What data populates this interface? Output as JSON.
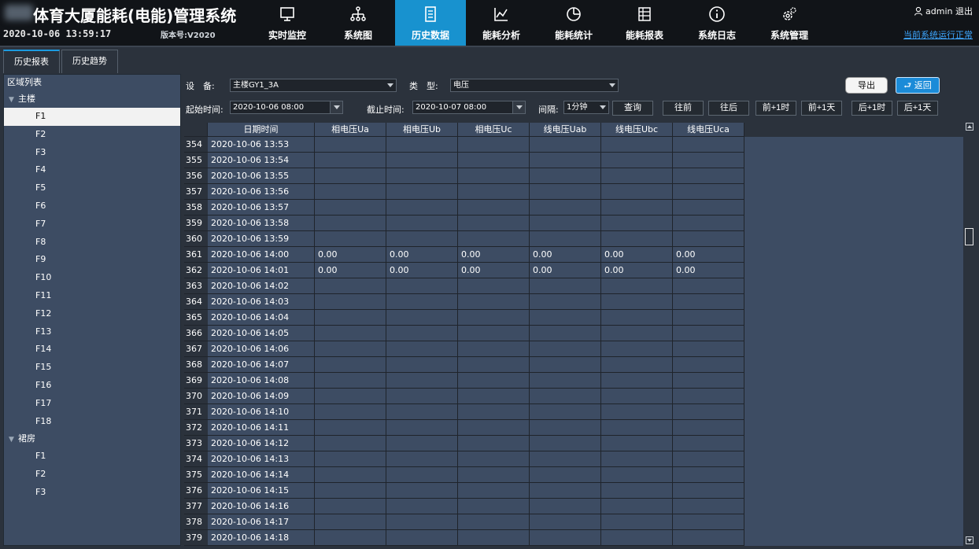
{
  "header": {
    "title": "体育大厦能耗(电能)管理系统",
    "datetime": "2020-10-06 13:59:17",
    "version": "版本号:V2020",
    "user": "admin",
    "logout": "退出",
    "status_link": "当前系统运行正常"
  },
  "nav": [
    {
      "label": "实时监控",
      "icon": "monitor-icon"
    },
    {
      "label": "系统图",
      "icon": "hierarchy-icon"
    },
    {
      "label": "历史数据",
      "icon": "document-icon",
      "active": true
    },
    {
      "label": "能耗分析",
      "icon": "line-chart-icon"
    },
    {
      "label": "能耗统计",
      "icon": "pie-chart-icon"
    },
    {
      "label": "能耗报表",
      "icon": "report-icon"
    },
    {
      "label": "系统日志",
      "icon": "info-icon"
    },
    {
      "label": "系统管理",
      "icon": "gear-icon"
    }
  ],
  "subtabs": [
    "历史报表",
    "历史趋势"
  ],
  "tree": {
    "title": "区域列表",
    "groups": [
      {
        "name": "主楼",
        "items": [
          "F1",
          "F2",
          "F3",
          "F4",
          "F5",
          "F6",
          "F7",
          "F8",
          "F9",
          "F10",
          "F11",
          "F12",
          "F13",
          "F14",
          "F15",
          "F16",
          "F17",
          "F18"
        ]
      },
      {
        "name": "裙房",
        "items": [
          "F1",
          "F2",
          "F3"
        ]
      }
    ],
    "selected": "F1"
  },
  "filters": {
    "device_label": "设　备:",
    "device_value": "主楼GY1_3A",
    "type_label": "类　型:",
    "type_value": "电压",
    "start_label": "起始时间:",
    "start_value": "2020-10-06 08:00",
    "end_label": "截止时间:",
    "end_value": "2020-10-07 08:00",
    "interval_label": "间隔:",
    "interval_value": "1分钟",
    "query": "查询",
    "prev": "往前",
    "next": "往后",
    "prev_hour": "前+1时",
    "prev_day": "前+1天",
    "next_hour": "后+1时",
    "next_day": "后+1天",
    "export": "导出",
    "back": "返回"
  },
  "table": {
    "columns": [
      "日期时间",
      "相电压Ua",
      "相电压Ub",
      "相电压Uc",
      "线电压Uab",
      "线电压Ubc",
      "线电压Uca"
    ],
    "rows": [
      {
        "idx": "354",
        "time": "2020-10-06 13:53",
        "vals": [
          "",
          "",
          "",
          "",
          "",
          ""
        ]
      },
      {
        "idx": "355",
        "time": "2020-10-06 13:54",
        "vals": [
          "",
          "",
          "",
          "",
          "",
          ""
        ]
      },
      {
        "idx": "356",
        "time": "2020-10-06 13:55",
        "vals": [
          "",
          "",
          "",
          "",
          "",
          ""
        ]
      },
      {
        "idx": "357",
        "time": "2020-10-06 13:56",
        "vals": [
          "",
          "",
          "",
          "",
          "",
          ""
        ]
      },
      {
        "idx": "358",
        "time": "2020-10-06 13:57",
        "vals": [
          "",
          "",
          "",
          "",
          "",
          ""
        ]
      },
      {
        "idx": "359",
        "time": "2020-10-06 13:58",
        "vals": [
          "",
          "",
          "",
          "",
          "",
          ""
        ]
      },
      {
        "idx": "360",
        "time": "2020-10-06 13:59",
        "vals": [
          "",
          "",
          "",
          "",
          "",
          ""
        ]
      },
      {
        "idx": "361",
        "time": "2020-10-06 14:00",
        "vals": [
          "0.00",
          "0.00",
          "0.00",
          "0.00",
          "0.00",
          "0.00"
        ]
      },
      {
        "idx": "362",
        "time": "2020-10-06 14:01",
        "vals": [
          "0.00",
          "0.00",
          "0.00",
          "0.00",
          "0.00",
          "0.00"
        ]
      },
      {
        "idx": "363",
        "time": "2020-10-06 14:02",
        "vals": [
          "",
          "",
          "",
          "",
          "",
          ""
        ]
      },
      {
        "idx": "364",
        "time": "2020-10-06 14:03",
        "vals": [
          "",
          "",
          "",
          "",
          "",
          ""
        ]
      },
      {
        "idx": "365",
        "time": "2020-10-06 14:04",
        "vals": [
          "",
          "",
          "",
          "",
          "",
          ""
        ]
      },
      {
        "idx": "366",
        "time": "2020-10-06 14:05",
        "vals": [
          "",
          "",
          "",
          "",
          "",
          ""
        ]
      },
      {
        "idx": "367",
        "time": "2020-10-06 14:06",
        "vals": [
          "",
          "",
          "",
          "",
          "",
          ""
        ]
      },
      {
        "idx": "368",
        "time": "2020-10-06 14:07",
        "vals": [
          "",
          "",
          "",
          "",
          "",
          ""
        ]
      },
      {
        "idx": "369",
        "time": "2020-10-06 14:08",
        "vals": [
          "",
          "",
          "",
          "",
          "",
          ""
        ]
      },
      {
        "idx": "370",
        "time": "2020-10-06 14:09",
        "vals": [
          "",
          "",
          "",
          "",
          "",
          ""
        ]
      },
      {
        "idx": "371",
        "time": "2020-10-06 14:10",
        "vals": [
          "",
          "",
          "",
          "",
          "",
          ""
        ]
      },
      {
        "idx": "372",
        "time": "2020-10-06 14:11",
        "vals": [
          "",
          "",
          "",
          "",
          "",
          ""
        ]
      },
      {
        "idx": "373",
        "time": "2020-10-06 14:12",
        "vals": [
          "",
          "",
          "",
          "",
          "",
          ""
        ]
      },
      {
        "idx": "374",
        "time": "2020-10-06 14:13",
        "vals": [
          "",
          "",
          "",
          "",
          "",
          ""
        ]
      },
      {
        "idx": "375",
        "time": "2020-10-06 14:14",
        "vals": [
          "",
          "",
          "",
          "",
          "",
          ""
        ]
      },
      {
        "idx": "376",
        "time": "2020-10-06 14:15",
        "vals": [
          "",
          "",
          "",
          "",
          "",
          ""
        ]
      },
      {
        "idx": "377",
        "time": "2020-10-06 14:16",
        "vals": [
          "",
          "",
          "",
          "",
          "",
          ""
        ]
      },
      {
        "idx": "378",
        "time": "2020-10-06 14:17",
        "vals": [
          "",
          "",
          "",
          "",
          "",
          ""
        ]
      },
      {
        "idx": "379",
        "time": "2020-10-06 14:18",
        "vals": [
          "",
          "",
          "",
          "",
          "",
          ""
        ]
      }
    ]
  },
  "colors": {
    "header_bg": "#111418",
    "active_nav": "#1892cf",
    "panel_bg": "#3d4c63",
    "page_bg": "#2b323c",
    "status_link": "#3ea7ff"
  }
}
